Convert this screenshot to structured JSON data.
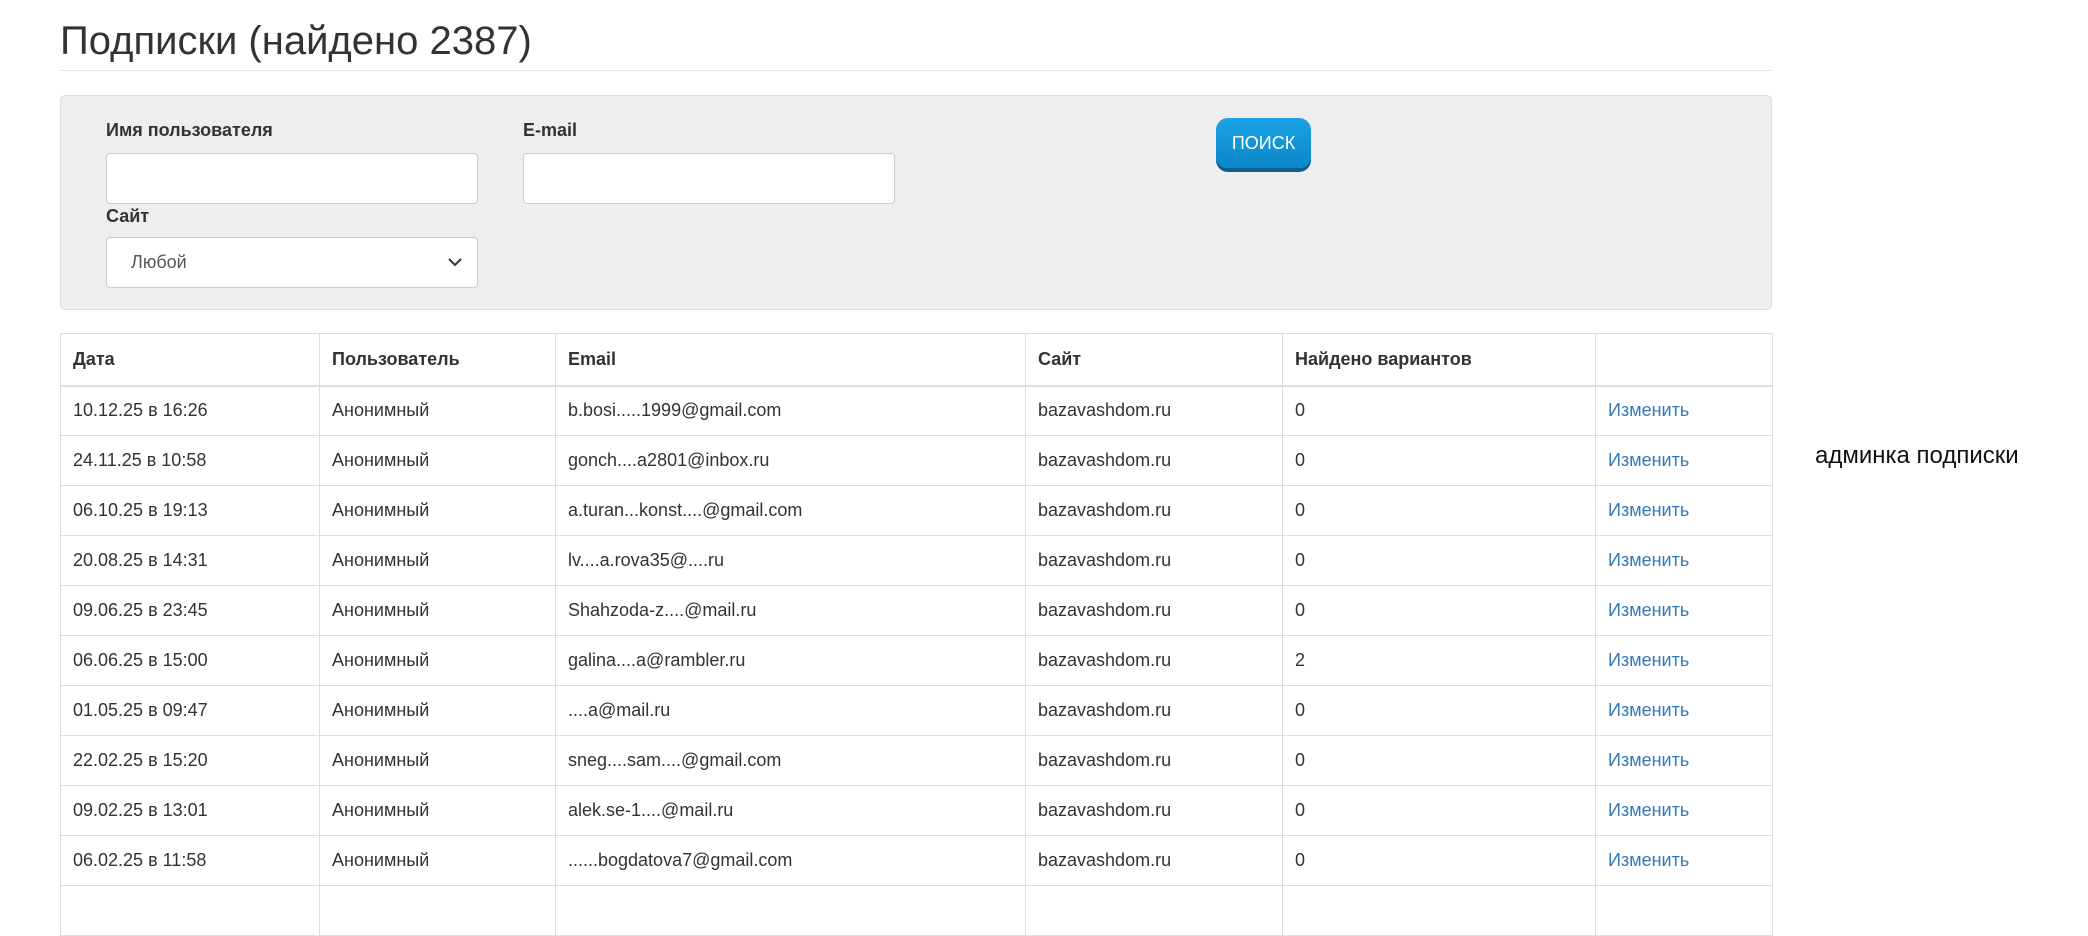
{
  "page": {
    "title": "Подписки (найдено 2387)"
  },
  "search": {
    "username_label": "Имя пользователя",
    "username_value": "",
    "email_label": "E-mail",
    "email_value": "",
    "site_label": "Сайт",
    "site_selected": "Любой",
    "button_label": "ПОИСК"
  },
  "table": {
    "columns": [
      "Дата",
      "Пользователь",
      "Email",
      "Сайт",
      "Найдено вариантов",
      ""
    ],
    "rows": [
      {
        "date": "10.12.25 в 16:26",
        "user": "Анонимный",
        "email": "b.bosi.....1999@gmail.com",
        "site": "bazavashdom.ru",
        "found": "0",
        "action": "Изменить"
      },
      {
        "date": "24.11.25 в 10:58",
        "user": "Анонимный",
        "email": "gonch....a2801@inbox.ru",
        "site": "bazavashdom.ru",
        "found": "0",
        "action": "Изменить"
      },
      {
        "date": "06.10.25 в 19:13",
        "user": "Анонимный",
        "email": "a.turan...konst....@gmail.com",
        "site": "bazavashdom.ru",
        "found": "0",
        "action": "Изменить"
      },
      {
        "date": "20.08.25 в 14:31",
        "user": "Анонимный",
        "email": "lv....a.rova35@....ru",
        "site": "bazavashdom.ru",
        "found": "0",
        "action": "Изменить"
      },
      {
        "date": "09.06.25 в 23:45",
        "user": "Анонимный",
        "email": "Shahzoda-z....@mail.ru",
        "site": "bazavashdom.ru",
        "found": "0",
        "action": "Изменить"
      },
      {
        "date": "06.06.25 в 15:00",
        "user": "Анонимный",
        "email": "galina....a@rambler.ru",
        "site": "bazavashdom.ru",
        "found": "2",
        "action": "Изменить"
      },
      {
        "date": "01.05.25 в 09:47",
        "user": "Анонимный",
        "email": "....a@mail.ru",
        "site": "bazavashdom.ru",
        "found": "0",
        "action": "Изменить"
      },
      {
        "date": "22.02.25 в 15:20",
        "user": "Анонимный",
        "email": "sneg....sam....@gmail.com",
        "site": "bazavashdom.ru",
        "found": "0",
        "action": "Изменить"
      },
      {
        "date": "09.02.25 в 13:01",
        "user": "Анонимный",
        "email": "alek.se-1....@mail.ru",
        "site": "bazavashdom.ru",
        "found": "0",
        "action": "Изменить"
      },
      {
        "date": "06.02.25 в 11:58",
        "user": "Анонимный",
        "email": "......bogdatova7@gmail.com",
        "site": "bazavashdom.ru",
        "found": "0",
        "action": "Изменить"
      },
      {
        "date": "",
        "user": "",
        "email": "",
        "site": "",
        "found": "",
        "action": ""
      }
    ]
  },
  "annotation": {
    "text": "админка подписки"
  },
  "icons": {
    "select_arrow": "chevron-down-icon"
  },
  "colors": {
    "button": "#0b8fd0",
    "link": "#337ab7",
    "panel": "#eeeeee"
  }
}
